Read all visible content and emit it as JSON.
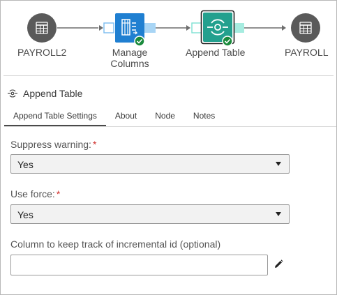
{
  "flow": {
    "nodes": [
      {
        "label": "PAYROLL2",
        "icon": "table-icon"
      },
      {
        "label": "Manage Columns",
        "label_line1": "Manage",
        "label_line2": "Columns",
        "icon": "manage-columns-icon"
      },
      {
        "label": "Append Table",
        "icon": "append-table-icon"
      },
      {
        "label": "PAYROLL",
        "icon": "table-icon"
      }
    ],
    "colors": {
      "table_node": "#5a5a5a",
      "manage_columns": "#1f7fd1",
      "append_table": "#23a08e",
      "port_light": "#a8d5f5",
      "port_teal": "#a6ece0",
      "status_ok": "#1a8a3c"
    }
  },
  "panel": {
    "title": "Append Table",
    "title_icon": "append-table-icon"
  },
  "tabs": [
    {
      "label": "Append Table Settings",
      "active": true
    },
    {
      "label": "About",
      "active": false
    },
    {
      "label": "Node",
      "active": false
    },
    {
      "label": "Notes",
      "active": false
    }
  ],
  "form": {
    "suppress_warning": {
      "label": "Suppress warning:",
      "required_mark": "*",
      "value": "Yes"
    },
    "use_force": {
      "label": "Use force:",
      "required_mark": "*",
      "value": "Yes"
    },
    "incremental_id": {
      "label": "Column to keep track of incremental id (optional)",
      "value": "",
      "edit_icon": "pencil-icon"
    }
  }
}
